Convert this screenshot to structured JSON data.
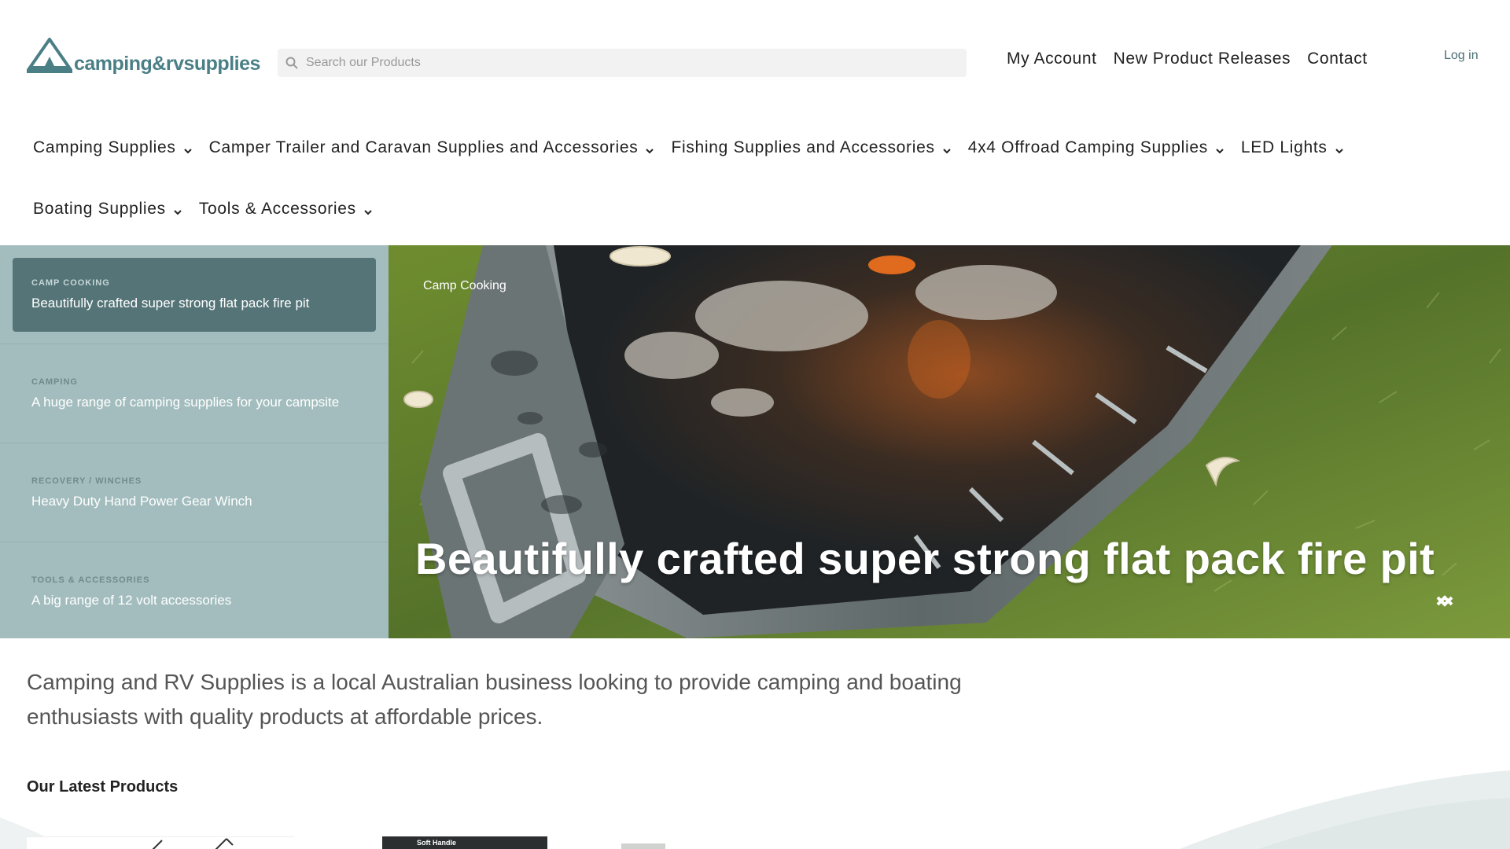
{
  "brand": {
    "logo_text": "camping&rvsupplies",
    "color": "#4a7f86"
  },
  "search": {
    "placeholder": "Search our Products",
    "icon": "search-icon"
  },
  "top_nav": {
    "items": [
      "My Account",
      "New Product Releases",
      "Contact"
    ],
    "login": "Log in"
  },
  "main_nav": {
    "row1": [
      "Camping Supplies",
      "Camper Trailer and Caravan Supplies and Accessories",
      "Fishing Supplies and Accessories",
      "4x4 Offroad Camping Supplies",
      "LED Lights"
    ],
    "row2": [
      "Boating Supplies",
      "Tools & Accessories"
    ]
  },
  "slider": {
    "entries": [
      {
        "category": "CAMP COOKING",
        "title": "Beautifully crafted super strong flat pack fire pit",
        "active": true
      },
      {
        "category": "CAMPING",
        "title": "A huge range of camping supplies for your campsite",
        "active": false
      },
      {
        "category": "RECOVERY / WINCHES",
        "title": "Heavy Duty Hand Power Gear Winch",
        "active": false
      },
      {
        "category": "TOOLS & ACCESSORIES",
        "title": "A big range of 12 volt accessories",
        "active": false
      }
    ],
    "current_tag": "Camp Cooking",
    "current_headline": "Beautifully crafted super strong flat pack fire pit",
    "side_color": "#a3bdbe",
    "active_color": "#557477"
  },
  "intro": {
    "text": "Camping and RV Supplies is a local Australian business looking to provide camping and boating enthusiasts with quality products at affordable prices."
  },
  "latest": {
    "heading": "Our Latest Products",
    "thumb_label": "Soft Handle"
  }
}
